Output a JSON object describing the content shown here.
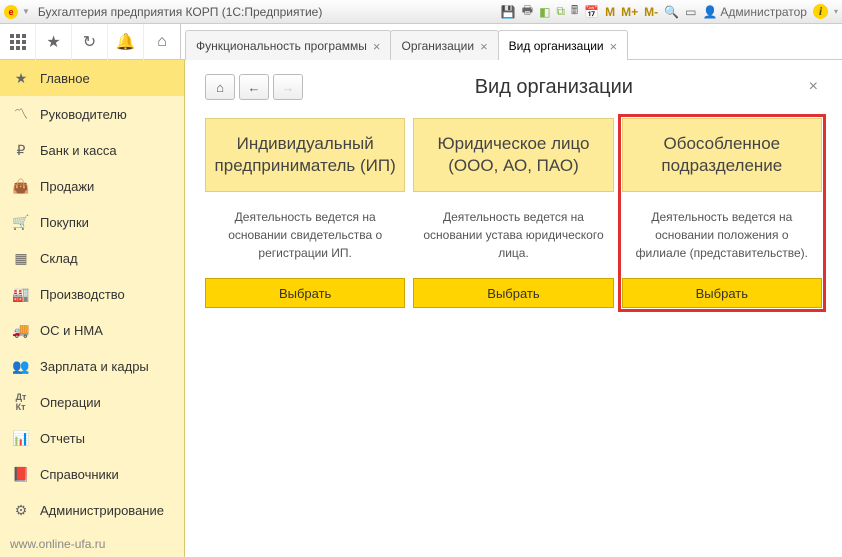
{
  "titlebar": {
    "title": "Бухгалтерия предприятия КОРП  (1С:Предприятие)",
    "user": "Администратор",
    "m_labels": [
      "M",
      "M+",
      "M-"
    ]
  },
  "tabs": [
    {
      "label": "Функциональность программы",
      "active": false
    },
    {
      "label": "Организации",
      "active": false
    },
    {
      "label": "Вид организации",
      "active": true
    }
  ],
  "sidebar": {
    "items": [
      {
        "label": "Главное",
        "icon": "star"
      },
      {
        "label": "Руководителю",
        "icon": "chart"
      },
      {
        "label": "Банк и касса",
        "icon": "ruble"
      },
      {
        "label": "Продажи",
        "icon": "bag"
      },
      {
        "label": "Покупки",
        "icon": "cart"
      },
      {
        "label": "Склад",
        "icon": "boxes"
      },
      {
        "label": "Производство",
        "icon": "factory"
      },
      {
        "label": "ОС и НМА",
        "icon": "truck"
      },
      {
        "label": "Зарплата и кадры",
        "icon": "people"
      },
      {
        "label": "Операции",
        "icon": "dtkt"
      },
      {
        "label": "Отчеты",
        "icon": "bars"
      },
      {
        "label": "Справочники",
        "icon": "book"
      },
      {
        "label": "Администрирование",
        "icon": "gear"
      }
    ],
    "footer": "www.online-ufa.ru"
  },
  "page": {
    "title": "Вид организации",
    "cards": [
      {
        "title": "Индивидуальный предприниматель (ИП)",
        "desc": "Деятельность ведется на основании свидетельства о регистрации ИП.",
        "button": "Выбрать",
        "highlight": false
      },
      {
        "title": "Юридическое лицо (ООО, АО, ПАО)",
        "desc": "Деятельность ведется на основании устава юридического лица.",
        "button": "Выбрать",
        "highlight": false
      },
      {
        "title": "Обособленное подразделение",
        "desc": "Деятельность ведется на основании положения о филиале (представительстве).",
        "button": "Выбрать",
        "highlight": true
      }
    ]
  }
}
